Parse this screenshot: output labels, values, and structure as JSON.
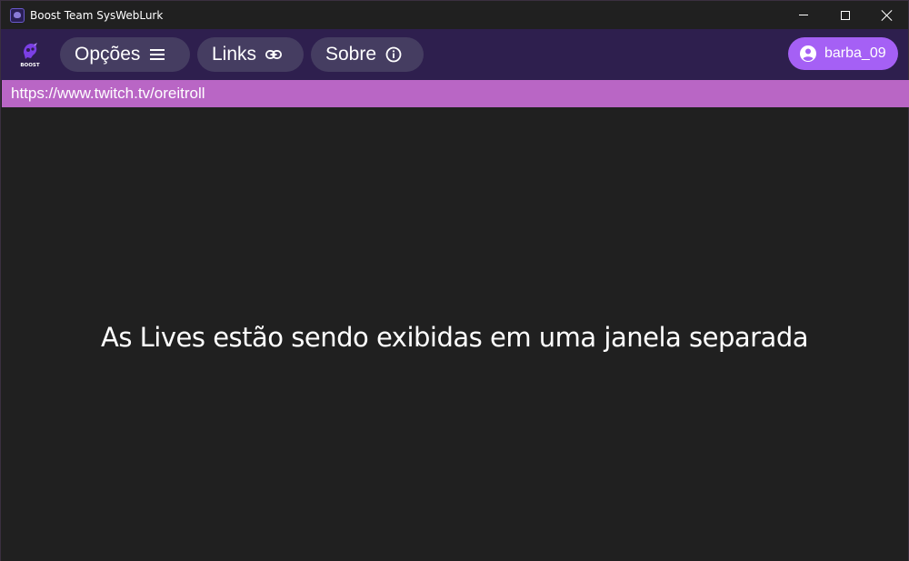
{
  "window": {
    "title": "Boost Team SysWebLurk",
    "controls": {
      "minimize_icon": "minimize-icon",
      "maximize_icon": "maximize-icon",
      "close_icon": "close-icon"
    }
  },
  "appbar": {
    "logo_icon": "boost-logo-icon",
    "logo_text": "BOOST",
    "menu": [
      {
        "label": "Opções",
        "icon": "hamburger-menu-icon"
      },
      {
        "label": "Links",
        "icon": "link-icon"
      },
      {
        "label": "Sobre",
        "icon": "info-icon"
      }
    ],
    "user": {
      "name": "barba_09",
      "icon": "account-circle-icon"
    }
  },
  "urlbar": {
    "url": "https://www.twitch.tv/oreitroll"
  },
  "main": {
    "message": "As Lives estão sendo exibidas em uma janela separada"
  },
  "colors": {
    "titlebar_bg": "#202020",
    "appbar_bg": "#2e1f4e",
    "pill_bg": "#453d61",
    "user_pill_bg": "#a560f5",
    "urlbar_bg": "#b966c5",
    "main_bg": "#202020"
  }
}
